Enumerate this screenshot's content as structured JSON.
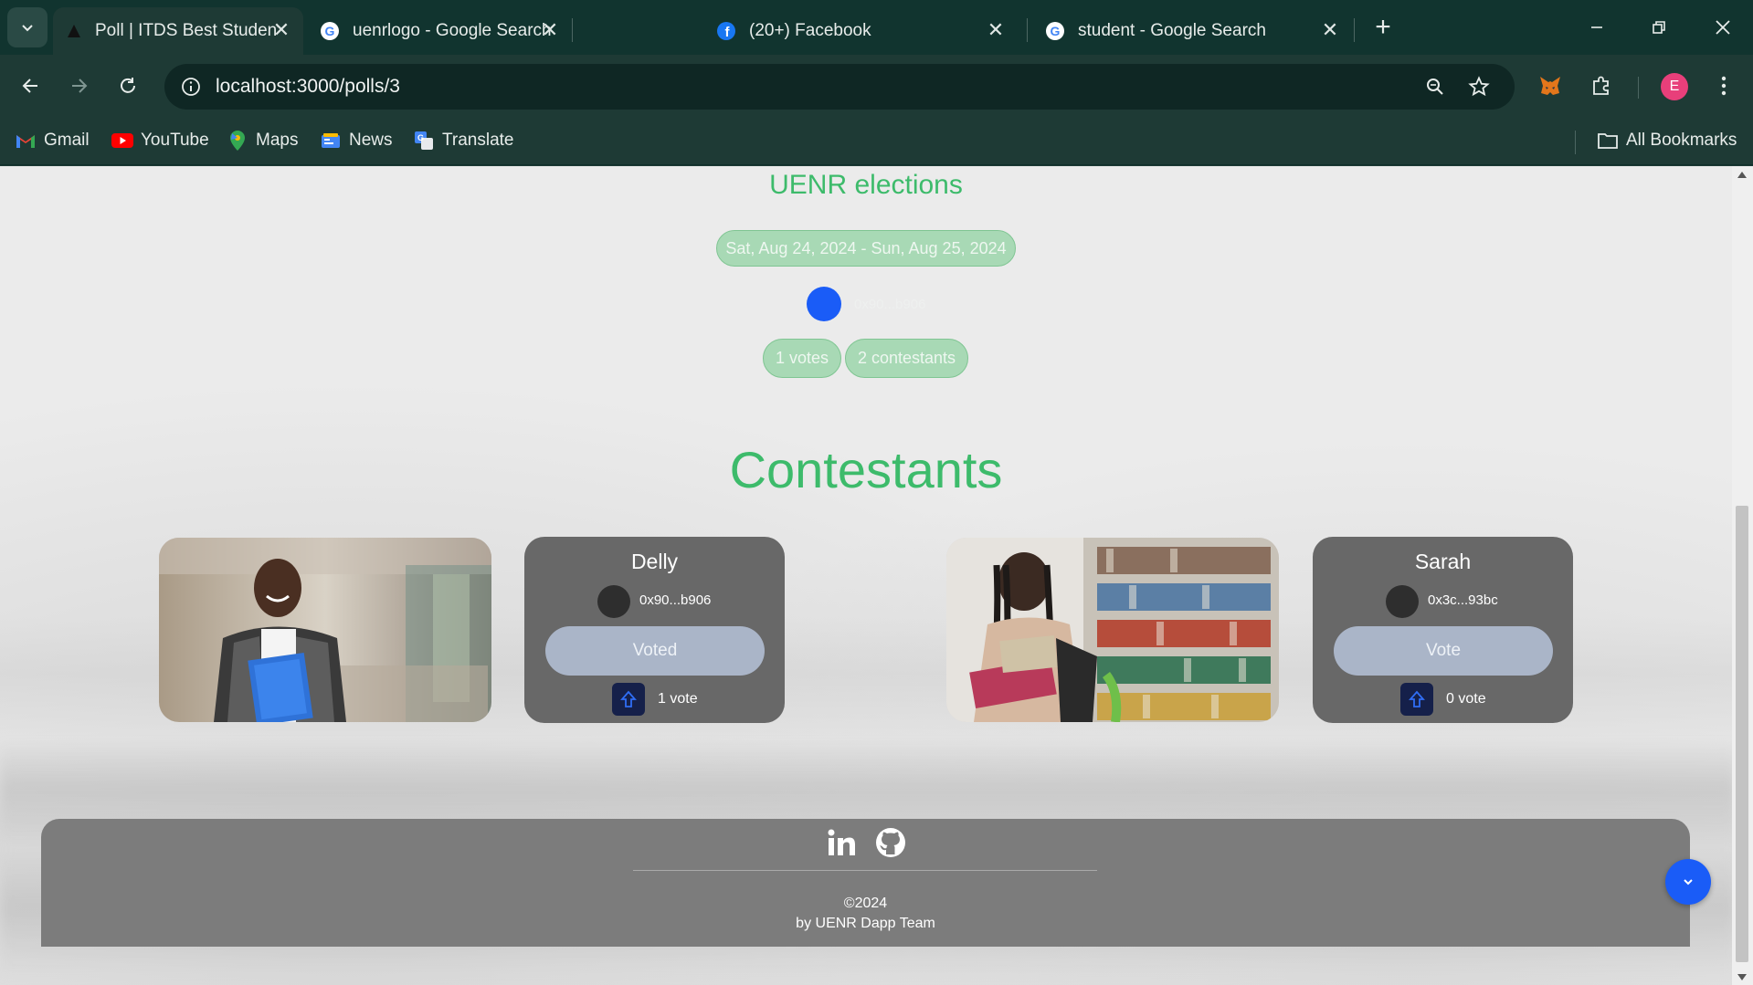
{
  "browser": {
    "tabs": [
      {
        "title": "Poll | ITDS Best Student Awards",
        "icon": "triangle-logo-icon",
        "active": true
      },
      {
        "title": "uenrlogo - Google Search",
        "icon": "google-icon",
        "active": false
      },
      {
        "title": "(20+) Facebook",
        "icon": "facebook-icon",
        "active": false
      },
      {
        "title": "student - Google Search",
        "icon": "google-icon",
        "active": false
      }
    ],
    "url": "localhost:3000/polls/3",
    "profile_initial": "E",
    "bookmarks": [
      {
        "label": "Gmail",
        "icon": "gmail-icon"
      },
      {
        "label": "YouTube",
        "icon": "youtube-icon"
      },
      {
        "label": "Maps",
        "icon": "maps-icon"
      },
      {
        "label": "News",
        "icon": "news-icon"
      },
      {
        "label": "Translate",
        "icon": "translate-icon"
      }
    ],
    "all_bookmarks_label": "All Bookmarks"
  },
  "poll": {
    "title": "UENR elections",
    "date_range": "Sat, Aug 24, 2024 - Sun, Aug 25, 2024",
    "owner_address": "0x90...b906",
    "votes_label": "1 votes",
    "contestants_label": "2 contestants"
  },
  "contestants_heading": "Contestants",
  "contestants": [
    {
      "name": "Delly",
      "address": "0x90...b906",
      "button_label": "Voted",
      "votes_label": "1 vote"
    },
    {
      "name": "Sarah",
      "address": "0x3c...93bc",
      "button_label": "Vote",
      "votes_label": "0 vote"
    }
  ],
  "footer": {
    "copyright": "©2024",
    "byline": "by UENR Dapp Team"
  },
  "colors": {
    "accent_green": "#3dbb6b",
    "pill_green": "#a8d9b5",
    "owner_blue": "#1a5cf7",
    "card_gray": "#686868",
    "button_gray": "#aab5c8",
    "chrome_dark": "#1e3a35"
  }
}
